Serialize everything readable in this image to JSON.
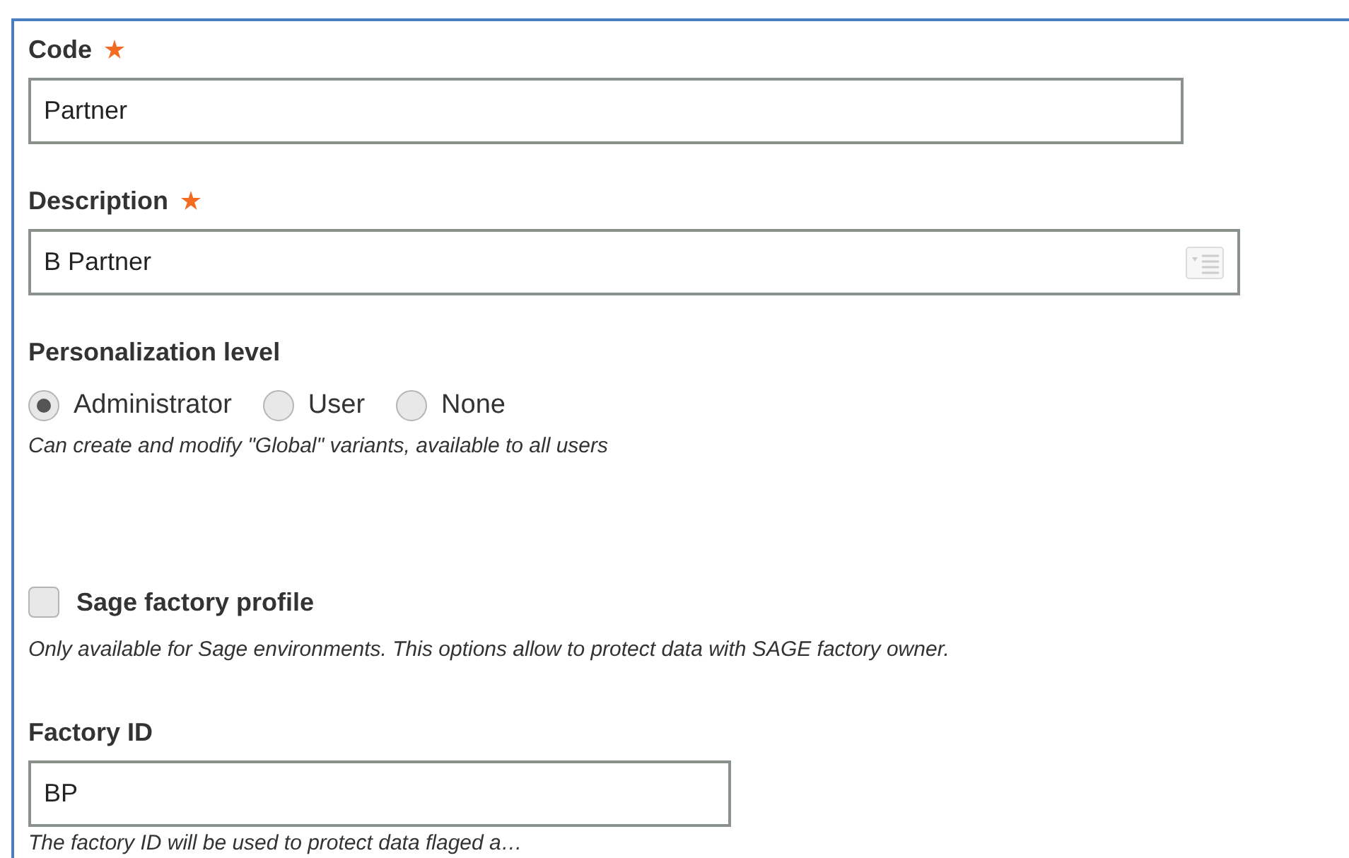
{
  "code": {
    "label": "Code",
    "required": true,
    "value": "Partner"
  },
  "description": {
    "label": "Description",
    "required": true,
    "value": "B Partner"
  },
  "personalization": {
    "label": "Personalization level",
    "options": [
      {
        "label": "Administrator",
        "selected": true
      },
      {
        "label": "User",
        "selected": false
      },
      {
        "label": "None",
        "selected": false
      }
    ],
    "hint": "Can create and modify \"Global\" variants, available to all users"
  },
  "sage_factory_profile": {
    "label": "Sage factory profile",
    "checked": false,
    "hint": "Only available for Sage environments. This options allow to protect data with SAGE factory owner."
  },
  "factory_id": {
    "label": "Factory ID",
    "value": "BP",
    "hint": "The factory ID will be used to protect data flaged a…"
  }
}
